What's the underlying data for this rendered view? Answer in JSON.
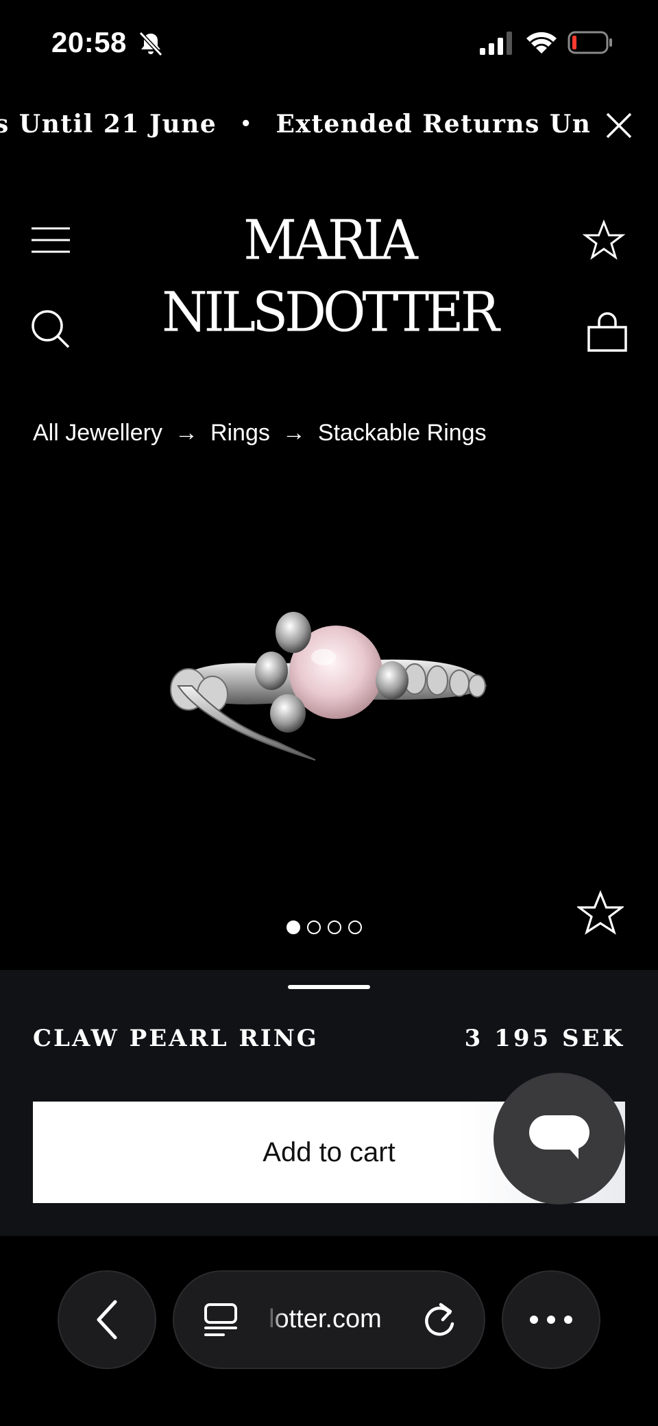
{
  "status_bar": {
    "time": "20:58",
    "icons": [
      "bell-slash-icon",
      "cellular-signal-icon",
      "wifi-icon",
      "battery-low-icon"
    ],
    "battery_color": "#ff3b30"
  },
  "announcement": {
    "items": [
      "s Until 21 June",
      "Extended Returns Until"
    ],
    "separator": "•",
    "close_icon": "close-icon"
  },
  "header": {
    "brand": "MARIA NILSDOTTER",
    "menu_icon": "hamburger-menu-icon",
    "favorites_icon": "star-icon",
    "search_icon": "search-icon",
    "cart_icon": "shopping-bag-icon"
  },
  "breadcrumb": {
    "items": [
      "All Jewellery",
      "Rings",
      "Stackable Rings"
    ],
    "separator": "→"
  },
  "product": {
    "image": "claw-pearl-ring-image",
    "carousel": {
      "count": 4,
      "active_index": 0
    },
    "favorite_icon": "star-icon",
    "name": "CLAW PEARL RING",
    "price": "3 195 SEK",
    "add_to_cart_label": "Add to cart",
    "chat_icon": "chat-bubble-icon"
  },
  "browser": {
    "back_icon": "chevron-left-icon",
    "tabs_icon": "tabs-icon",
    "url": "lotter.com",
    "reload_icon": "reload-icon",
    "more_icon": "ellipsis-icon"
  },
  "colors": {
    "background": "#000000",
    "sheet": "#111216",
    "button": "#ffffff",
    "chat": "#3a3a3c"
  }
}
